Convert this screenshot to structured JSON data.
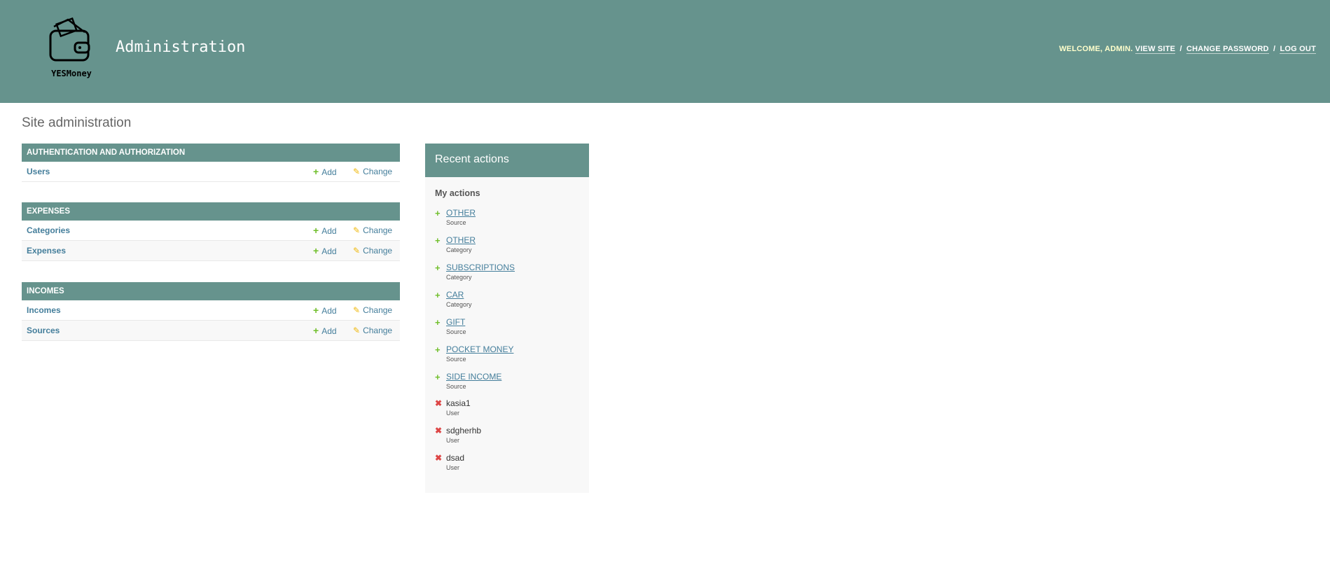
{
  "header": {
    "logo_text": "YESMoney",
    "site_title": "Administration",
    "welcome": "Welcome,",
    "username": "admin.",
    "view_site": "View site",
    "change_password": "Change password",
    "log_out": "Log out",
    "sep": "/"
  },
  "page_title": "Site administration",
  "modules": [
    {
      "caption": "Authentication and Authorization",
      "rows": [
        {
          "name": "Users",
          "add": "Add",
          "change": "Change"
        }
      ]
    },
    {
      "caption": "Expenses",
      "rows": [
        {
          "name": "Categories",
          "add": "Add",
          "change": "Change"
        },
        {
          "name": "Expenses",
          "add": "Add",
          "change": "Change"
        }
      ]
    },
    {
      "caption": "Incomes",
      "rows": [
        {
          "name": "Incomes",
          "add": "Add",
          "change": "Change"
        },
        {
          "name": "Sources",
          "add": "Add",
          "change": "Change"
        }
      ]
    }
  ],
  "recent": {
    "title": "Recent actions",
    "subhead": "My actions",
    "actions": [
      {
        "title": "OTHER",
        "type": "Source",
        "kind": "add"
      },
      {
        "title": "OTHER",
        "type": "Category",
        "kind": "add"
      },
      {
        "title": "SUBSCRIPTIONS",
        "type": "Category",
        "kind": "add"
      },
      {
        "title": "CAR",
        "type": "Category",
        "kind": "add"
      },
      {
        "title": "GIFT",
        "type": "Source",
        "kind": "add"
      },
      {
        "title": "POCKET MONEY",
        "type": "Source",
        "kind": "add"
      },
      {
        "title": "SIDE INCOME",
        "type": "Source",
        "kind": "add"
      },
      {
        "title": "kasia1",
        "type": "User",
        "kind": "delete"
      },
      {
        "title": "sdgherhb",
        "type": "User",
        "kind": "delete"
      },
      {
        "title": "dsad",
        "type": "User",
        "kind": "delete"
      }
    ]
  },
  "icons": {
    "add": "plus-icon",
    "change": "pencil-icon",
    "delete": "x-icon"
  },
  "colors": {
    "header": "#66938d",
    "link": "#447e9b",
    "add": "#70bf2b",
    "change": "#efb80b",
    "delete": "#dd4646"
  }
}
